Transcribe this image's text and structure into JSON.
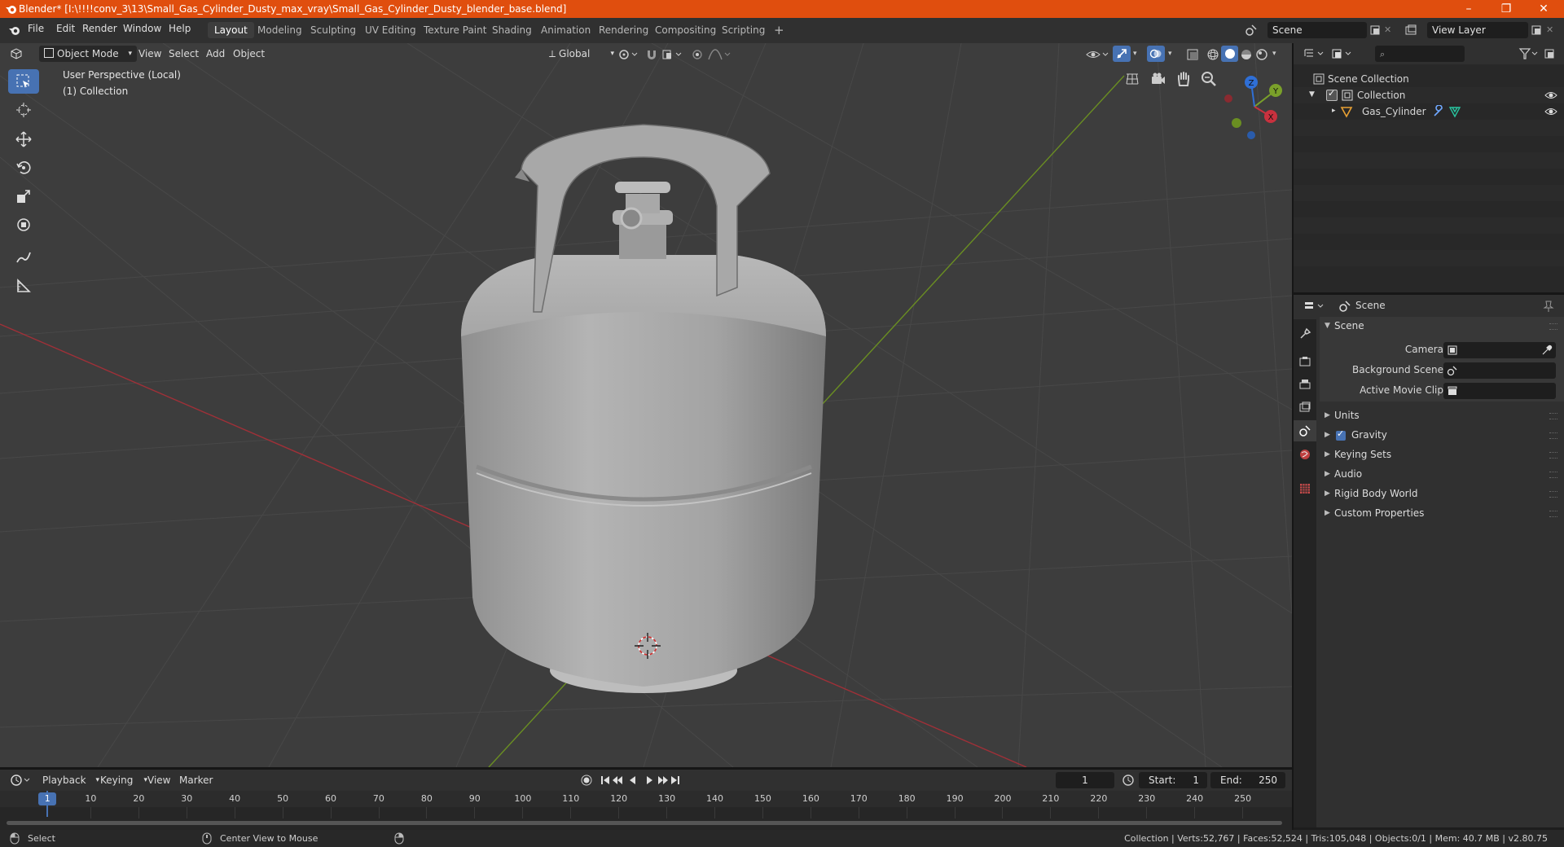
{
  "window": {
    "title": "Blender* [I:\\!!!!conv_3\\13\\Small_Gas_Cylinder_Dusty_max_vray\\Small_Gas_Cylinder_Dusty_blender_base.blend]",
    "minimize": "–",
    "maximize": "❐",
    "close": "✕"
  },
  "menu": {
    "items": [
      "File",
      "Edit",
      "Render",
      "Window",
      "Help"
    ],
    "workspaces": [
      "Layout",
      "Modeling",
      "Sculpting",
      "UV Editing",
      "Texture Paint",
      "Shading",
      "Animation",
      "Rendering",
      "Compositing",
      "Scripting"
    ],
    "add_workspace": "+",
    "scene_name": "Scene",
    "view_layer": "View Layer"
  },
  "viewport": {
    "mode": "Object Mode",
    "menus": [
      "View",
      "Select",
      "Add",
      "Object"
    ],
    "transform_orientation": "Global",
    "perspective_label": "User Perspective (Local)",
    "collection_label": "(1) Collection",
    "gizmo_axes": {
      "x": "X",
      "y": "Y",
      "z": "Z"
    }
  },
  "outliner": {
    "root": "Scene Collection",
    "collection": "Collection",
    "object": "Gas_Cylinder"
  },
  "properties": {
    "context": "Scene",
    "panel_title": "Scene",
    "fields": [
      {
        "label": "Camera"
      },
      {
        "label": "Background Scene"
      },
      {
        "label": "Active Movie Clip"
      }
    ],
    "subpanels": [
      "Units",
      "Gravity",
      "Keying Sets",
      "Audio",
      "Rigid Body World",
      "Custom Properties"
    ],
    "gravity_checked": true
  },
  "timeline": {
    "menus": [
      "Playback",
      "Keying",
      "View",
      "Marker"
    ],
    "current_frame": "1",
    "start_label": "Start:",
    "start_value": "1",
    "end_label": "End:",
    "end_value": "250",
    "ruler": [
      "1",
      "10",
      "20",
      "30",
      "40",
      "50",
      "60",
      "70",
      "80",
      "90",
      "100",
      "110",
      "120",
      "130",
      "140",
      "150",
      "160",
      "170",
      "180",
      "190",
      "200",
      "210",
      "220",
      "230",
      "240",
      "250"
    ]
  },
  "statusbar": {
    "left_action": "Select",
    "middle_action": "Center View to Mouse",
    "stats": "Collection | Verts:52,767 | Faces:52,524 | Tris:105,048 | Objects:0/1 | Mem: 40.7 MB | v2.80.75"
  },
  "colors": {
    "titlebar": "#e04e0e",
    "accent": "#4772b3",
    "viewport_bg": "#3d3d3d",
    "x_axis": "#c8313e",
    "y_axis": "#7aa02a",
    "z_axis": "#2f6fd6"
  }
}
